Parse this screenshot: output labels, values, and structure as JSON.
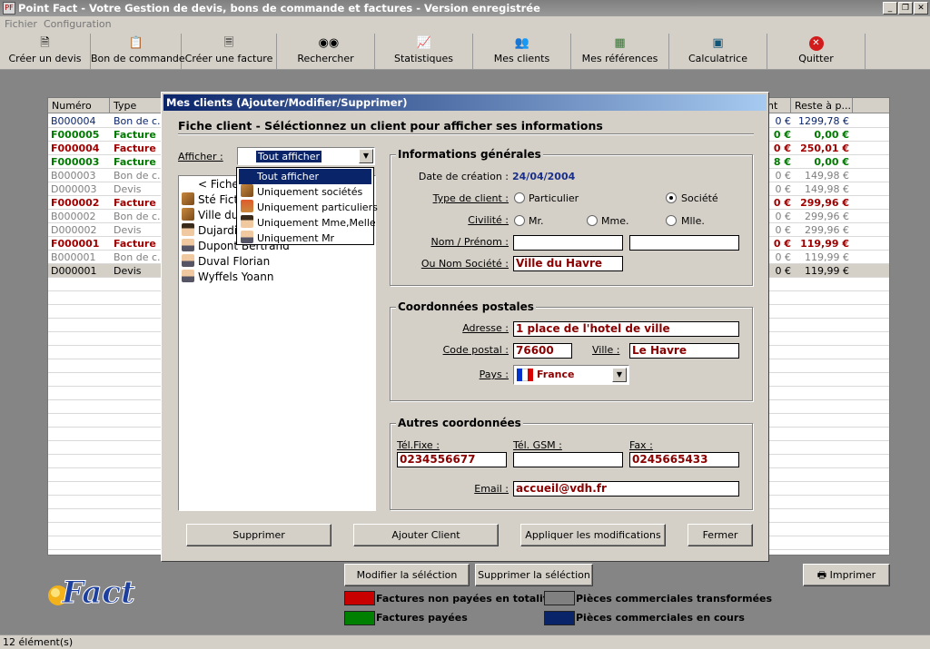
{
  "window": {
    "title": "Point Fact - Votre Gestion de devis, bons de commande et factures - Version enregistrée"
  },
  "menu": [
    "Fichier",
    "Configuration"
  ],
  "toolbar": [
    {
      "label": "Créer un devis",
      "icon": "document-icon"
    },
    {
      "label": "Bon de commande",
      "icon": "clipboard-icon"
    },
    {
      "label": "Créer une facture",
      "icon": "invoice-icon"
    },
    {
      "label": "Rechercher",
      "icon": "binoculars-icon"
    },
    {
      "label": "Statistiques",
      "icon": "chart-icon"
    },
    {
      "label": "Mes clients",
      "icon": "people-icon"
    },
    {
      "label": "Mes références",
      "icon": "database-icon"
    },
    {
      "label": "Calculatrice",
      "icon": "calculator-icon"
    },
    {
      "label": "Quitter",
      "icon": "close-icon"
    }
  ],
  "grid": {
    "headers": {
      "numero": "Numéro",
      "type": "Type",
      "montant": "nt",
      "reste": "Reste à p..."
    },
    "rows": [
      {
        "numero": "B000004",
        "type": "Bon de c...",
        "montant": "0 €",
        "reste": "1299,78 €",
        "color": "#0a246a",
        "bold": false
      },
      {
        "numero": "F000005",
        "type": "Facture",
        "montant": "0 €",
        "reste": "0,00 €",
        "color": "#007a00",
        "bold": true
      },
      {
        "numero": "F000004",
        "type": "Facture",
        "montant": "0 €",
        "reste": "250,01 €",
        "color": "#a00000",
        "bold": true
      },
      {
        "numero": "F000003",
        "type": "Facture",
        "montant": "8 €",
        "reste": "0,00 €",
        "color": "#007a00",
        "bold": true
      },
      {
        "numero": "B000003",
        "type": "Bon de c...",
        "montant": "0 €",
        "reste": "149,98 €",
        "color": "#7f7f7f",
        "bold": false
      },
      {
        "numero": "D000003",
        "type": "Devis",
        "montant": "0 €",
        "reste": "149,98 €",
        "color": "#7f7f7f",
        "bold": false
      },
      {
        "numero": "F000002",
        "type": "Facture",
        "montant": "0 €",
        "reste": "299,96 €",
        "color": "#a00000",
        "bold": true
      },
      {
        "numero": "B000002",
        "type": "Bon de c...",
        "montant": "0 €",
        "reste": "299,96 €",
        "color": "#7f7f7f",
        "bold": false
      },
      {
        "numero": "D000002",
        "type": "Devis",
        "montant": "0 €",
        "reste": "299,96 €",
        "color": "#7f7f7f",
        "bold": false
      },
      {
        "numero": "F000001",
        "type": "Facture",
        "montant": "0 €",
        "reste": "119,99 €",
        "color": "#a00000",
        "bold": true
      },
      {
        "numero": "B000001",
        "type": "Bon de c...",
        "montant": "0 €",
        "reste": "119,99 €",
        "color": "#7f7f7f",
        "bold": false
      },
      {
        "numero": "D000001",
        "type": "Devis",
        "montant": "0 €",
        "reste": "119,99 €",
        "color": "#000000",
        "bold": false
      }
    ]
  },
  "bottom": {
    "modify_label": "Modifier la séléction",
    "delete_label": "Supprimer la séléction",
    "print_label": "Imprimer",
    "legend": [
      {
        "label": "Factures non payées en totalité",
        "color": "#c80000"
      },
      {
        "label": "Pièces commerciales transformées",
        "color": "#808080"
      },
      {
        "label": "Factures payées",
        "color": "#008000"
      },
      {
        "label": "Pièces commerciales en cours",
        "color": "#0a246a"
      }
    ],
    "logo_text": "Fact"
  },
  "status": {
    "text": "12 élément(s)"
  },
  "dialog": {
    "title": "Mes clients (Ajouter/Modifier/Supprimer)",
    "heading": "Fiche client - Séléctionnez un client pour afficher ses informations",
    "afficher_label": "Afficher :",
    "afficher_value": "Tout afficher",
    "dropdown_options": [
      {
        "label": "Tout afficher",
        "icon": "",
        "selected": true
      },
      {
        "label": "Uniquement sociétés",
        "icon": "company-icon"
      },
      {
        "label": "Uniquement particuliers",
        "icon": "person-icon"
      },
      {
        "label": "Uniquement Mme,Melle",
        "icon": "woman-icon"
      },
      {
        "label": "Uniquement Mr",
        "icon": "man-icon"
      }
    ],
    "client_list": [
      {
        "label": "< Fiche",
        "icon": ""
      },
      {
        "label": "Sté Ficti",
        "icon": "company-icon"
      },
      {
        "label": "Ville du",
        "icon": "company-icon",
        "selected": true
      },
      {
        "label": "Dujardin",
        "icon": "woman-icon"
      },
      {
        "label": "Dupont Bertrand",
        "icon": "man-icon"
      },
      {
        "label": "Duval Florian",
        "icon": "man-icon"
      },
      {
        "label": "Wyffels Yoann",
        "icon": "man-icon"
      }
    ],
    "general": {
      "title": "Informations générales",
      "date_label": "Date de création :",
      "date_value": "24/04/2004",
      "type_label": "Type de client :",
      "type_particulier": "Particulier",
      "type_societe": "Société",
      "civilite_label": "Civilité :",
      "civ_mr": "Mr.",
      "civ_mme": "Mme.",
      "civ_mlle": "Mlle.",
      "nom_label": "Nom / Prénom :",
      "nom_value": "",
      "prenom_value": "",
      "societe_label": "Ou Nom Société :",
      "societe_value": "Ville du Havre"
    },
    "postal": {
      "title": "Coordonnées postales",
      "adresse_label": "Adresse :",
      "adresse_value": "1 place de l'hotel de ville",
      "cp_label": "Code postal :",
      "cp_value": "76600",
      "ville_label": "Ville :",
      "ville_value": "Le Havre",
      "pays_label": "Pays :",
      "pays_value": "France"
    },
    "other": {
      "title": "Autres coordonnées",
      "tel_label": "Tél.Fixe :",
      "tel_value": "0234556677",
      "gsm_label": "Tél. GSM :",
      "gsm_value": "",
      "fax_label": "Fax :",
      "fax_value": "0245665433",
      "email_label": "Email :",
      "email_value": "accueil@vdh.fr"
    },
    "buttons": {
      "delete": "Supprimer",
      "add": "Ajouter Client",
      "apply": "Appliquer les modifications",
      "close": "Fermer"
    }
  }
}
